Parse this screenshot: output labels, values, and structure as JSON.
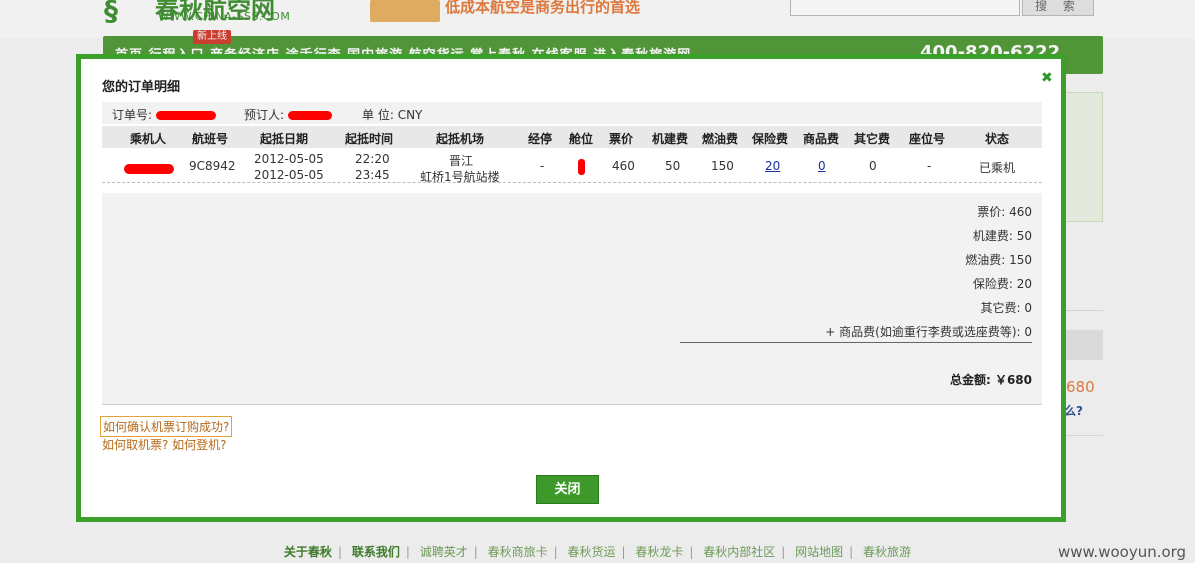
{
  "background": {
    "logo_name": "春秋航空网",
    "logo_url": "WWW.CHINA-SSS.COM",
    "slogan": "低成本航空是商务出行的首选",
    "search_button": "搜 索",
    "new_badge": "新上线",
    "nav_text": "首页  行程入口  商务经济店  途舌行李  国内旅游  航空货运  掌上春秋  在线客服      进入春秋旅游网",
    "phone": "400-820-6222",
    "right_number": "680",
    "right_question": "么?"
  },
  "modal": {
    "title": "您的订单明细",
    "order_no_label": "订单号:",
    "booker_label": "预订人:",
    "currency_label": "单 位:",
    "currency": "CNY",
    "columns": [
      "乘机人",
      "航班号",
      "起抵日期",
      "起抵时间",
      "起抵机场",
      "经停",
      "舱位",
      "票价",
      "机建费",
      "燃油费",
      "保险费",
      "商品费",
      "其它费",
      "座位号",
      "状态"
    ],
    "row": {
      "flight_no": "9C8942",
      "date_dep": "2012-05-05",
      "date_arr": "2012-05-05",
      "time_dep": "22:20",
      "time_arr": "23:45",
      "airport_dep": "晋江",
      "airport_arr": "虹桥1号航站楼",
      "stopover": "-",
      "fare": "460",
      "airport_tax": "50",
      "fuel_fee": "150",
      "insurance": "20",
      "goods_fee": "0",
      "other_fee": "0",
      "seat": "-",
      "status": "已乘机"
    },
    "summary": {
      "fare": "票价: 460",
      "airport_tax": "机建费: 50",
      "fuel": "燃油费: 150",
      "insurance": "保险费: 20",
      "other": "其它费: 0",
      "goods": "+  商品费(如逾重行李费或选座费等): 0",
      "total": "总金额: ￥680"
    },
    "help_confirm": "如何确认机票订购成功?",
    "help_pickup": "如何取机票? 如何登机?",
    "close_label": "关闭"
  },
  "footer": {
    "links": [
      "关于春秋",
      "联系我们",
      "诚聘英才",
      "春秋商旅卡",
      "春秋货运",
      "春秋龙卡",
      "春秋内部社区",
      "网站地图",
      "春秋旅游"
    ],
    "watermark": "www.wooyun.org"
  },
  "colors": {
    "accent_green": "#3aa02a",
    "nav_green": "#4e9a35",
    "redaction": "#ff0000",
    "link_blue": "#1a2f9a",
    "help_orange": "#b36a1a"
  }
}
